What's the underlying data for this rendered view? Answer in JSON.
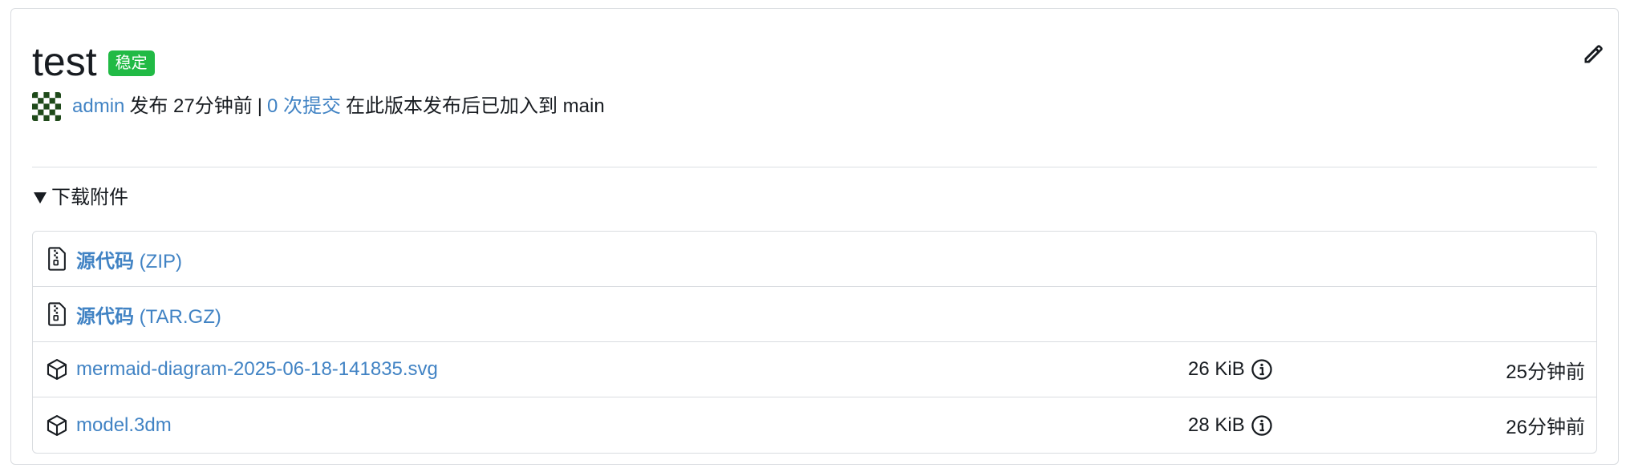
{
  "release": {
    "title": "test",
    "badge": "稳定",
    "author": "admin",
    "published": "发布 27分钟前",
    "separator": "|",
    "commits": "0 次提交",
    "commits_suffix": "在此版本发布后已加入到 main"
  },
  "downloads": {
    "summary": "下载附件",
    "assets": [
      {
        "name_strong": "源代码",
        "name": "(ZIP)",
        "icon": "file-zip-icon"
      },
      {
        "name_strong": "源代码",
        "name": "(TAR.GZ)",
        "icon": "file-zip-icon"
      },
      {
        "name": "mermaid-diagram-2025-06-18-141835.svg",
        "size": "26 KiB",
        "time": "25分钟前",
        "icon": "package-icon"
      },
      {
        "name": "model.3dm",
        "size": "28 KiB",
        "time": "26分钟前",
        "icon": "package-icon"
      }
    ]
  },
  "colors": {
    "accent": "#4183c4",
    "badge": "#21ba45",
    "text": "#181c21",
    "border": "#d9dce0"
  }
}
